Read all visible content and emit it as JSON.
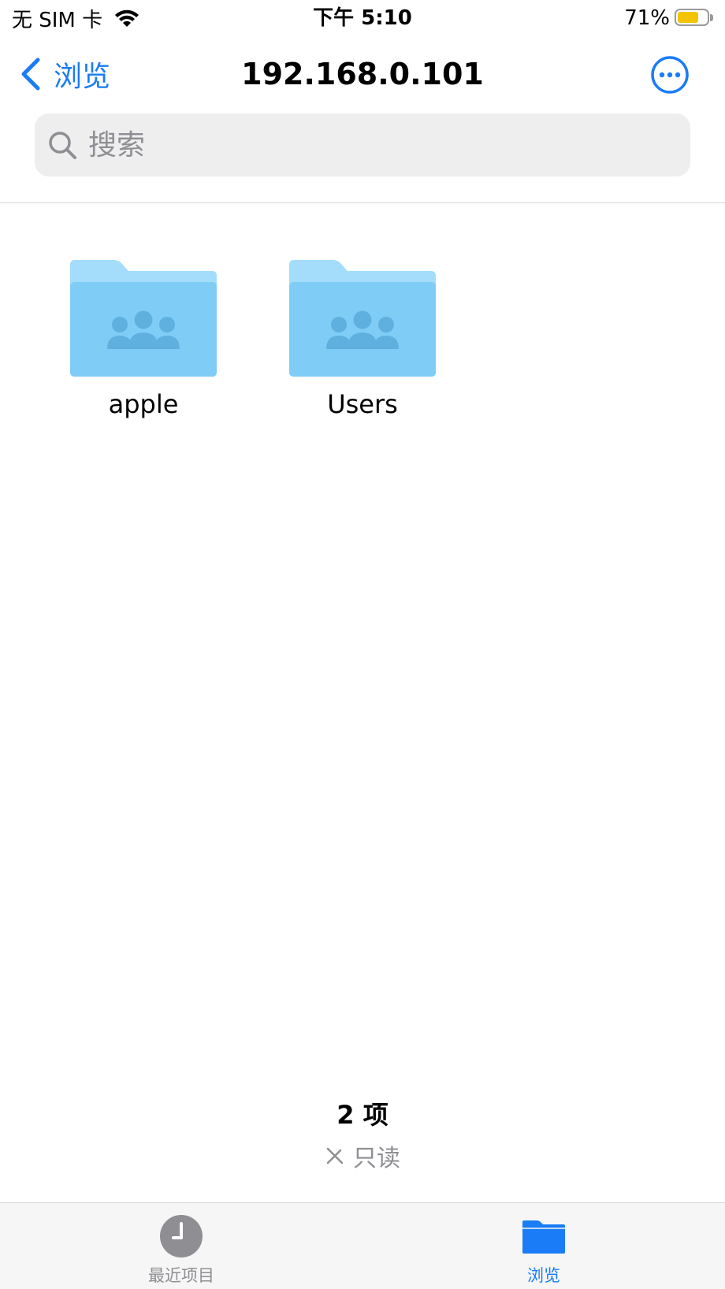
{
  "status_bar": {
    "carrier": "无 SIM 卡",
    "time": "下午 5:10",
    "battery_percent": "71%",
    "battery_level": 0.71,
    "battery_color": "#f5c400"
  },
  "nav": {
    "back_label": "浏览",
    "title": "192.168.0.101",
    "more_icon": "ellipsis-circle-icon",
    "accent_color": "#1a7cf6"
  },
  "search": {
    "placeholder": "搜索",
    "value": ""
  },
  "folders": [
    {
      "name": "apple",
      "icon": "shared-folder-icon"
    },
    {
      "name": "Users",
      "icon": "shared-folder-icon"
    }
  ],
  "footer": {
    "item_count": "2 项",
    "read_only": "只读"
  },
  "tab_bar": {
    "tabs": [
      {
        "label": "最近项目",
        "icon": "clock-icon",
        "selected": false
      },
      {
        "label": "浏览",
        "icon": "folder-icon",
        "selected": true
      }
    ]
  }
}
